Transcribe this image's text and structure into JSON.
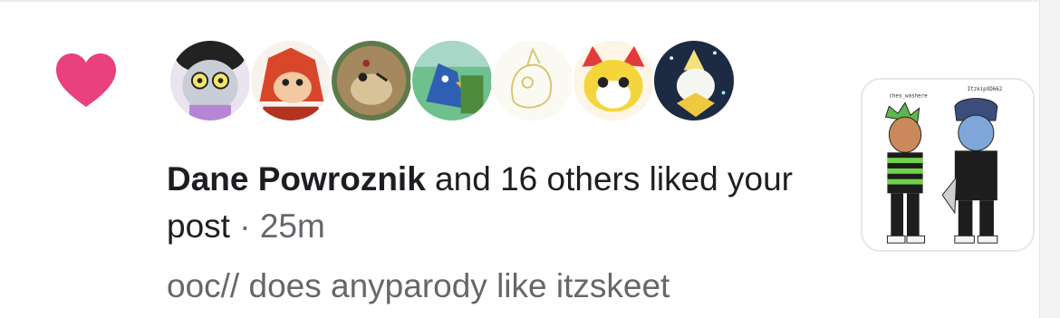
{
  "notification": {
    "actor_name": "Dane Powroznik",
    "action_text": " and 16 others liked your post",
    "separator": " · ",
    "time": "25m",
    "preview": "ooc// does anyparody like itzskeet",
    "reaction_icon": "heart-icon",
    "reaction_color": "#e8417e"
  },
  "avatars": [
    {
      "icon": "cartoon-cat-avatar"
    },
    {
      "icon": "red-hedgehog-avatar"
    },
    {
      "icon": "brown-hedgehog-avatar"
    },
    {
      "icon": "blue-bird-avatar"
    },
    {
      "icon": "sketch-avatar"
    },
    {
      "icon": "yellow-fox-avatar"
    },
    {
      "icon": "jirachi-avatar"
    }
  ],
  "post_thumbnail": {
    "caption_left": "ches_washere",
    "caption_right": "ItzkipXD662"
  }
}
